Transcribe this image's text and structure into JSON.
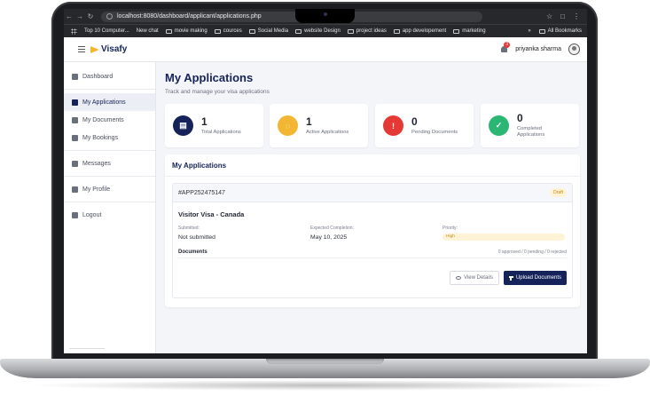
{
  "browser": {
    "url": "localhost:8080/dashboard/applicant/applications.php",
    "bookmarks": [
      "Top 10 Computer...",
      "New chat",
      "movie making",
      "cources",
      "Social Media",
      "website Design",
      "project ideas",
      "app developement",
      "marketing"
    ],
    "all_bookmarks": "All Bookmarks",
    "more": "»"
  },
  "header": {
    "logo": "Visafy",
    "notification_count": "3",
    "user_name": "priyanka sharma"
  },
  "sidebar": {
    "items": [
      {
        "label": "Dashboard",
        "icon": "home-icon"
      },
      {
        "label": "My Applications",
        "icon": "file-icon"
      },
      {
        "label": "My Documents",
        "icon": "document-icon"
      },
      {
        "label": "My Bookings",
        "icon": "calendar-icon"
      },
      {
        "label": "Messages",
        "icon": "envelope-icon"
      },
      {
        "label": "My Profile",
        "icon": "user-icon"
      },
      {
        "label": "Logout",
        "icon": "logout-icon"
      }
    ]
  },
  "page": {
    "title": "My Applications",
    "subtitle": "Track and manage your visa applications"
  },
  "stats": [
    {
      "value": "1",
      "label": "Total Applications",
      "color": "#15235a",
      "icon": "file-icon"
    },
    {
      "value": "1",
      "label": "Active Applications",
      "color": "#f2b632",
      "icon": "spinner-icon"
    },
    {
      "value": "0",
      "label": "Pending Documents",
      "color": "#e53935",
      "icon": "alert-icon"
    },
    {
      "value": "0",
      "label": "Completed Applications",
      "color": "#2bb673",
      "icon": "check-icon"
    }
  ],
  "applications_panel": {
    "title": "My Applications",
    "application": {
      "id": "#APP252475147",
      "status": "Draft",
      "visa": "Visitor Visa - Canada",
      "submitted_label": "Submitted:",
      "submitted_value": "Not submitted",
      "completion_label": "Expected Completion:",
      "completion_value": "May 10, 2025",
      "priority_label": "Priority:",
      "priority_value": "High",
      "documents_label": "Documents",
      "documents_counts": "0 approved / 0 pending / 0 rejected",
      "view_button": "View Details",
      "upload_button": "Upload Documents"
    }
  }
}
